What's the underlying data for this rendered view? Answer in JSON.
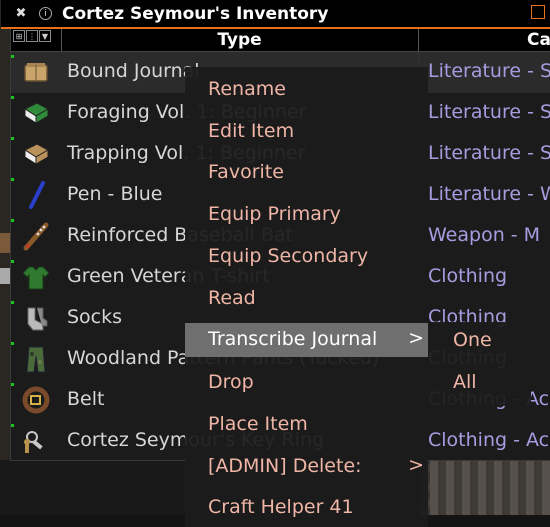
{
  "window": {
    "title": "Cortez Seymour's Inventory"
  },
  "header": {
    "type_label": "Type",
    "category_label": "Cat"
  },
  "rows": [
    {
      "name": "Bound Journal",
      "category": "Literature - S",
      "icon": "journal-icon",
      "color": "#c9a46a"
    },
    {
      "name": "Foraging Vol. 1: Beginner",
      "category": "Literature - S",
      "icon": "book-icon",
      "color": "#2f8a3a"
    },
    {
      "name": "Trapping Vol. 1: Beginner",
      "category": "Literature - S",
      "icon": "book-icon",
      "color": "#b8925a"
    },
    {
      "name": "Pen - Blue",
      "category": "Literature - W",
      "icon": "pen-icon",
      "color": "#2a3fc9"
    },
    {
      "name": "Reinforced Baseball Bat",
      "category": "Weapon - M",
      "icon": "bat-icon",
      "color": "#8a5a2a"
    },
    {
      "name": "Green Veteran T-shirt",
      "category": "Clothing",
      "icon": "tshirt-icon",
      "color": "#2f7a2f"
    },
    {
      "name": "Socks",
      "category": "Clothing",
      "icon": "socks-icon",
      "color": "#bbbbbb"
    },
    {
      "name": "Woodland Pattern Pants (Tucked)",
      "category": "Clothing",
      "icon": "pants-icon",
      "color": "#4a6a3a"
    },
    {
      "name": "Belt",
      "category": "Clothing - Ac",
      "icon": "belt-icon",
      "color": "#7a4a2a"
    },
    {
      "name": "Cortez Seymour's Key Ring",
      "category": "Clothing - Ac",
      "icon": "keyring-icon",
      "color": "#c8c8c8"
    }
  ],
  "context_menu": {
    "items": [
      {
        "label": "Rename",
        "arrow": ""
      },
      {
        "label": "Edit Item",
        "arrow": ""
      },
      {
        "label": "Favorite",
        "arrow": ""
      },
      {
        "label": "Equip Primary",
        "arrow": ""
      },
      {
        "label": "Equip Secondary",
        "arrow": ""
      },
      {
        "label": "Read",
        "arrow": ""
      },
      {
        "label": "Transcribe Journal",
        "arrow": ">"
      },
      {
        "label": "Drop",
        "arrow": ""
      },
      {
        "label": "Place Item",
        "arrow": ""
      },
      {
        "label": "[ADMIN] Delete:",
        "arrow": ">"
      },
      {
        "label": "Craft Helper 41",
        "arrow": ""
      }
    ],
    "highlighted": "Transcribe Journal"
  },
  "submenu": {
    "items": [
      {
        "label": "One"
      },
      {
        "label": "All"
      }
    ]
  },
  "colors": {
    "accent": "#e6711a",
    "category_text": "#a79ce0",
    "menu_text": "#efb5a6",
    "highlight_bg": "#6f6f6f"
  }
}
